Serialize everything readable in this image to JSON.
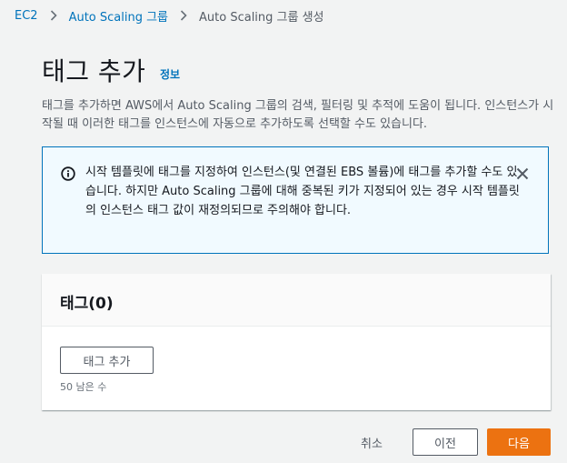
{
  "breadcrumb": {
    "items": [
      {
        "label": "EC2"
      },
      {
        "label": "Auto Scaling 그룹"
      },
      {
        "label": "Auto Scaling 그룹 생성"
      }
    ]
  },
  "page": {
    "title": "태그 추가",
    "info_link": "정보",
    "description": "태그를 추가하면 AWS에서 Auto Scaling 그룹의 검색, 필터링 및 추적에 도움이 됩니다. 인스턴스가 시작될 때 이러한 태그를 인스턴스에 자동으로 추가하도록 선택할 수도 있습니다."
  },
  "alert": {
    "icon": "info-circle-icon",
    "text": "시작 템플릿에 태그를 지정하여 인스턴스(및 연결된 EBS 볼륨)에 태그를 추가할 수도 있습니다. 하지만 Auto Scaling 그룹에 대해 중복된 키가 지정되어 있는 경우 시작 템플릿의 인스턴스 태그 값이 재정의되므로 주의해야 합니다.",
    "close_icon": "close-icon"
  },
  "tags_panel": {
    "title": "태그(0)",
    "add_button": "태그 추가",
    "remaining": "50 남은 수"
  },
  "footer": {
    "cancel": "취소",
    "previous": "이전",
    "next": "다음"
  },
  "colors": {
    "link": "#0073bb",
    "primary": "#ec7211",
    "alert_border": "#0073bb",
    "alert_bg": "#f1faff",
    "page_bg": "#f2f3f3"
  }
}
